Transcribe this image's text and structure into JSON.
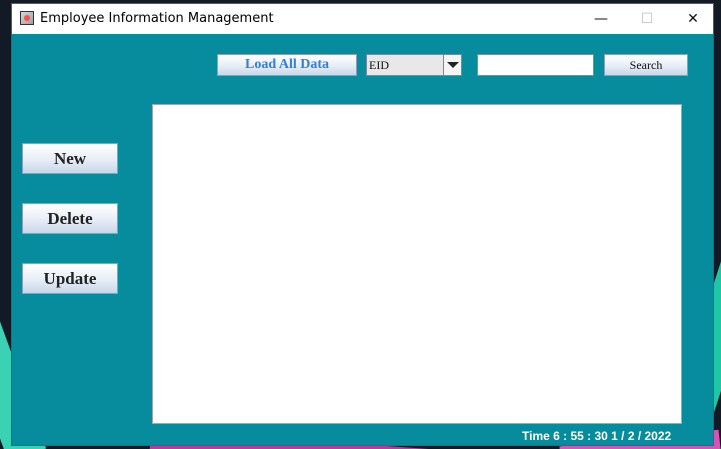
{
  "window": {
    "title": "Employee Information Management",
    "minimize_glyph": "—",
    "maximize_glyph": "☐",
    "close_glyph": "✕",
    "background_color": "#078c9d",
    "app_icon": "app-icon"
  },
  "toolbar": {
    "load_all_label": "Load All Data",
    "search_field_select": "EID",
    "search_input_value": "",
    "search_label": "Search"
  },
  "sidebar": {
    "new_label": "New",
    "delete_label": "Delete",
    "update_label": "Update"
  },
  "status": {
    "time_text": "Time 6 : 55 : 30 1 / 2 / 2022"
  }
}
